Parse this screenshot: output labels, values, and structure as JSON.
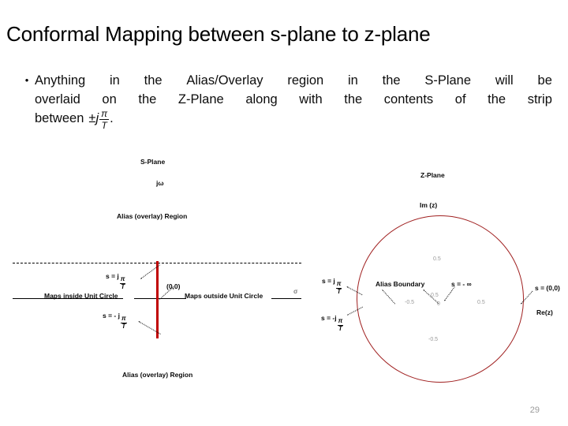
{
  "slide": {
    "title": "Conformal Mapping between s-plane to z-plane",
    "page_number": "29"
  },
  "body": {
    "bullet_marker": "•",
    "line1_words": [
      "Anything",
      "in",
      "the",
      "Alias/Overlay",
      "region",
      "in",
      "the",
      "S-Plane",
      "will",
      "be"
    ],
    "line2_words": [
      "overlaid",
      "on",
      "the",
      "Z-Plane",
      "along",
      "with",
      "the",
      "contents",
      "of",
      "the",
      "strip"
    ],
    "line3_prefix": "between",
    "line3_pm_j": "±j",
    "line3_frac_num": "π",
    "line3_frac_den": "T",
    "line3_suffix": "."
  },
  "s_plane": {
    "title": "S-Plane",
    "imag_axis_label": "jω",
    "real_axis_label": "σ",
    "alias_top_label": "Alias (overlay) Region",
    "alias_bottom_label": "Alias (overlay) Region",
    "origin_label": "(0,0)",
    "pos_pole_prefix": "s = j",
    "neg_pole_prefix": "s = - j",
    "frac_num": "π",
    "frac_den": "T",
    "inside_label": "Maps inside Unit Circle",
    "outside_label": "Maps outside Unit Circle",
    "strip_color": "#c00000"
  },
  "z_plane": {
    "title": "Z-Plane",
    "imag_axis_label": "Im (z)",
    "real_axis_label": "Re(z)",
    "alias_boundary_label": "Alias Boundary",
    "s_infinity_label": "s = - ∞",
    "s_origin_label": "s = (0,0)",
    "pos_pole_prefix": "s = j",
    "neg_pole_prefix": "s = -j",
    "frac_num": "π",
    "frac_den": "T",
    "circle_color": "#a02020",
    "ticks": {
      "top": "0.5",
      "bottom": "-0.5",
      "left": "-0.5",
      "right": "0.5",
      "center": "0",
      "center_upper": "0.5"
    }
  }
}
